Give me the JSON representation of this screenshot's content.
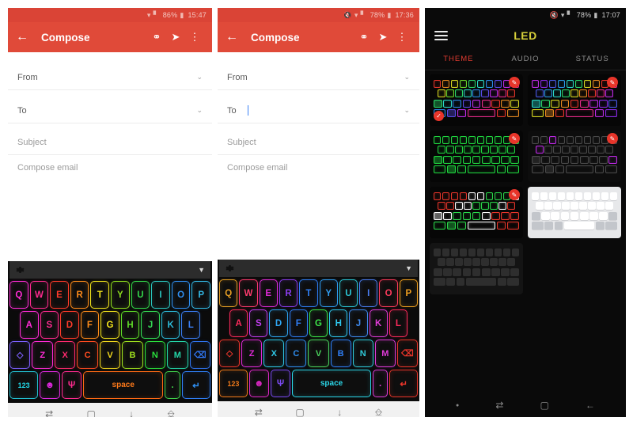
{
  "panels": [
    {
      "id": "compose-unfocused",
      "status": {
        "battery": "86%",
        "time": "15:47",
        "icons": [
          "wifi-icon",
          "signal-icon",
          "battery-icon"
        ]
      },
      "appbar": {
        "back": "←",
        "title": "Compose",
        "attach": "attach-icon",
        "send": "send-icon",
        "overflow": "⋮"
      },
      "form": {
        "from_label": "From",
        "to_label": "To",
        "subject_placeholder": "Subject",
        "body_placeholder": "Compose email",
        "chevron": "⌄",
        "to_focused": false
      },
      "keyboard": {
        "settings_icon": "gear-icon",
        "collapse_icon": "▼",
        "row1": [
          "Q",
          "W",
          "E",
          "R",
          "T",
          "Y",
          "U",
          "I",
          "O",
          "P"
        ],
        "row2": [
          "A",
          "S",
          "D",
          "F",
          "G",
          "H",
          "J",
          "K",
          "L"
        ],
        "row3": [
          "◇",
          "Z",
          "X",
          "C",
          "V",
          "B",
          "N",
          "M",
          "⌫"
        ],
        "row4": [
          "123",
          "☻",
          "\u0001",
          "space",
          ".",
          "↵"
        ],
        "row1_colors": [
          "#ff2bd6",
          "#ff2a8f",
          "#ff3b2a",
          "#ff8c1a",
          "#f2e31c",
          "#8ede1e",
          "#33d94a",
          "#2bc7c0",
          "#2f8ef0",
          "#33b9e6"
        ],
        "row2_colors": [
          "#ff2bd6",
          "#ff2a8f",
          "#ff3b2a",
          "#ff8c1a",
          "#f2e31c",
          "#5fdc28",
          "#34dd55",
          "#2bb9d8",
          "#3a7df2"
        ],
        "row3_colors": [
          "#7d60ff",
          "#ff2bd6",
          "#ff2a6e",
          "#ff4b20",
          "#f0d61c",
          "#9fe01e",
          "#2ae03c",
          "#24d6a8",
          "#2f74f0"
        ],
        "row4_colors": [
          "#22bfd0",
          "#e028e0",
          "#ff2a8f",
          "#ff6a14",
          "#3fd24a",
          "#2f7ef5"
        ],
        "space_label_color": "#ff7a1a",
        "n123_color": "#22d7e8",
        "enter_color": "#2f8ef0"
      },
      "nav": {
        "items": [
          "switch-icon",
          "recents-icon",
          "down-icon",
          "keyboard-icon"
        ],
        "theme": "light"
      }
    },
    {
      "id": "compose-focused",
      "status": {
        "battery": "78%",
        "time": "17:36",
        "icons": [
          "mute-icon",
          "wifi-icon",
          "signal-icon",
          "battery-icon"
        ]
      },
      "appbar": {
        "back": "←",
        "title": "Compose",
        "attach": "attach-icon",
        "send": "send-icon",
        "overflow": "⋮"
      },
      "form": {
        "from_label": "From",
        "to_label": "To",
        "subject_placeholder": "Subject",
        "body_placeholder": "Compose email",
        "chevron": "⌄",
        "to_focused": true
      },
      "keyboard": {
        "settings_icon": "gear-icon",
        "collapse_icon": "▼",
        "row1": [
          "Q",
          "W",
          "E",
          "R",
          "T",
          "Y",
          "U",
          "I",
          "O",
          "P"
        ],
        "row2": [
          "A",
          "S",
          "D",
          "F",
          "G",
          "H",
          "J",
          "K",
          "L"
        ],
        "row3": [
          "◇",
          "Z",
          "X",
          "C",
          "V",
          "B",
          "N",
          "M",
          "⌫"
        ],
        "row4": [
          "123",
          "☻",
          "\u0001",
          "space",
          ".",
          "↵"
        ],
        "row1_colors": [
          "#e8a024",
          "#ff3b6e",
          "#e02ad8",
          "#8c3df0",
          "#2f7ef5",
          "#2f9cf0",
          "#2bc9d8",
          "#4a7ef2",
          "#ff3b5c",
          "#f0a020"
        ],
        "row2_colors": [
          "#ff2a5c",
          "#c23df0",
          "#2fa8f5",
          "#2f7ef5",
          "#3ce84a",
          "#2fc9f0",
          "#3f8cf2",
          "#e03bd8",
          "#ff2a5c"
        ],
        "row3_colors": [
          "#e8352a",
          "#e02ad8",
          "#2fc9e8",
          "#2f8ef0",
          "#4ad35c",
          "#2f7ef5",
          "#2fc9d8",
          "#e03bd8",
          "#e8352a"
        ],
        "row4_colors": [
          "#f07a1a",
          "#e028c8",
          "#7a4af0",
          "#2bd6e8",
          "#e03bd8",
          "#e8352a"
        ],
        "space_label_color": "#2bd6e8",
        "n123_color": "#f07a1a",
        "enter_color": "#e8352a"
      },
      "nav": {
        "items": [
          "switch-icon",
          "recents-icon",
          "down-icon",
          "keyboard-icon"
        ],
        "theme": "light"
      }
    }
  ],
  "led_app": {
    "status": {
      "battery": "78%",
      "time": "17:07",
      "icons": [
        "mute-icon",
        "wifi-icon",
        "signal-icon",
        "battery-icon"
      ]
    },
    "menu_icon": "hamburger-icon",
    "title": "LED",
    "title_color": "#d6cf3a",
    "tabs": [
      {
        "label": "THEME",
        "active": true
      },
      {
        "label": "AUDIO",
        "active": false
      },
      {
        "label": "STATUS",
        "active": false
      }
    ],
    "active_tab_color": "#e03b30",
    "edit_badge_icon": "pencil-icon",
    "selected_icon": "check-icon",
    "themes": [
      {
        "name": "rainbow-neon",
        "selected": true,
        "editable": true,
        "style": "rainbow",
        "bg": "#060606"
      },
      {
        "name": "rainbow-violet",
        "selected": false,
        "editable": true,
        "style": "violet",
        "bg": "#060606"
      },
      {
        "name": "matrix-green",
        "selected": false,
        "editable": true,
        "style": "green",
        "bg": "#060606"
      },
      {
        "name": "minimal-dark",
        "selected": false,
        "editable": true,
        "style": "minimal",
        "bg": "#0d0d0d"
      },
      {
        "name": "red-white-green",
        "selected": false,
        "editable": true,
        "style": "redwhite",
        "bg": "#060606"
      },
      {
        "name": "ios-light",
        "selected": false,
        "editable": false,
        "style": "light",
        "bg": "#e7e8ea"
      },
      {
        "name": "gray-dark",
        "selected": false,
        "editable": false,
        "style": "gray",
        "bg": "#141414"
      }
    ],
    "nav": {
      "items": [
        "dot-icon",
        "switch-icon",
        "recents-icon",
        "back-icon"
      ],
      "theme": "dark"
    }
  }
}
